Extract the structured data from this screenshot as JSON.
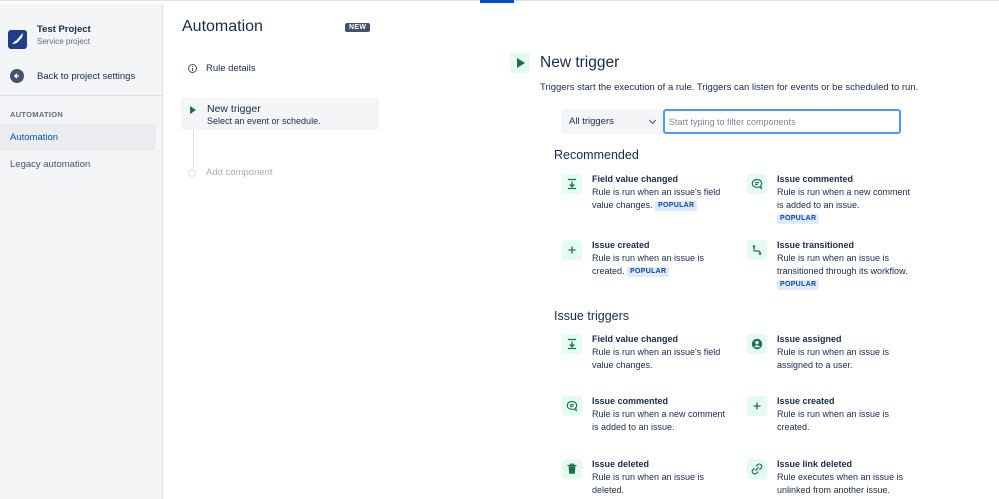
{
  "sidebar": {
    "project_name": "Test Project",
    "project_type": "Service project",
    "back_label": "Back to project settings",
    "section_heading": "AUTOMATION",
    "items": [
      {
        "label": "Automation",
        "active": true
      },
      {
        "label": "Legacy automation",
        "active": false
      }
    ]
  },
  "builder": {
    "title": "Automation",
    "badge": "NEW",
    "rule_details": "Rule details",
    "trigger_title": "New trigger",
    "trigger_subtitle": "Select an event or schedule.",
    "add_component": "Add component"
  },
  "panel": {
    "title": "New trigger",
    "description": "Triggers start the execution of a rule. Triggers can listen for events or be scheduled to run.",
    "filter_select": "All triggers",
    "filter_placeholder": "Start typing to filter components",
    "popular_label": "POPULAR",
    "recommended": {
      "heading": "Recommended",
      "items": [
        {
          "name": "Field value changed",
          "desc": "Rule is run when an issue's field value changes.",
          "popular": true,
          "icon": "field-value-icon"
        },
        {
          "name": "Issue commented",
          "desc": "Rule is run when a new comment is added to an issue.",
          "popular": true,
          "icon": "comment-icon"
        },
        {
          "name": "Issue created",
          "desc": "Rule is run when an issue is created.",
          "popular": true,
          "icon": "plus-icon"
        },
        {
          "name": "Issue transitioned",
          "desc": "Rule is run when an issue is transitioned through its workflow.",
          "popular": true,
          "icon": "transition-icon"
        }
      ]
    },
    "issue_triggers": {
      "heading": "Issue triggers",
      "items": [
        {
          "name": "Field value changed",
          "desc": "Rule is run when an issue's field value changes.",
          "icon": "field-value-icon"
        },
        {
          "name": "Issue assigned",
          "desc": "Rule is run when an issue is assigned to a user.",
          "icon": "user-icon"
        },
        {
          "name": "Issue commented",
          "desc": "Rule is run when a new comment is added to an issue.",
          "icon": "comment-icon"
        },
        {
          "name": "Issue created",
          "desc": "Rule is run when an issue is created.",
          "icon": "plus-icon"
        },
        {
          "name": "Issue deleted",
          "desc": "Rule is run when an issue is deleted.",
          "icon": "trash-icon"
        },
        {
          "name": "Issue link deleted",
          "desc": "Rule executes when an issue is unlinked from another issue.",
          "icon": "unlink-icon"
        }
      ]
    }
  },
  "colors": {
    "accent": "#0052cc",
    "trigger_green": "#216e4e",
    "icon_bg": "#e3fcef",
    "popular_bg": "#deebff",
    "popular_text": "#0747a6"
  }
}
